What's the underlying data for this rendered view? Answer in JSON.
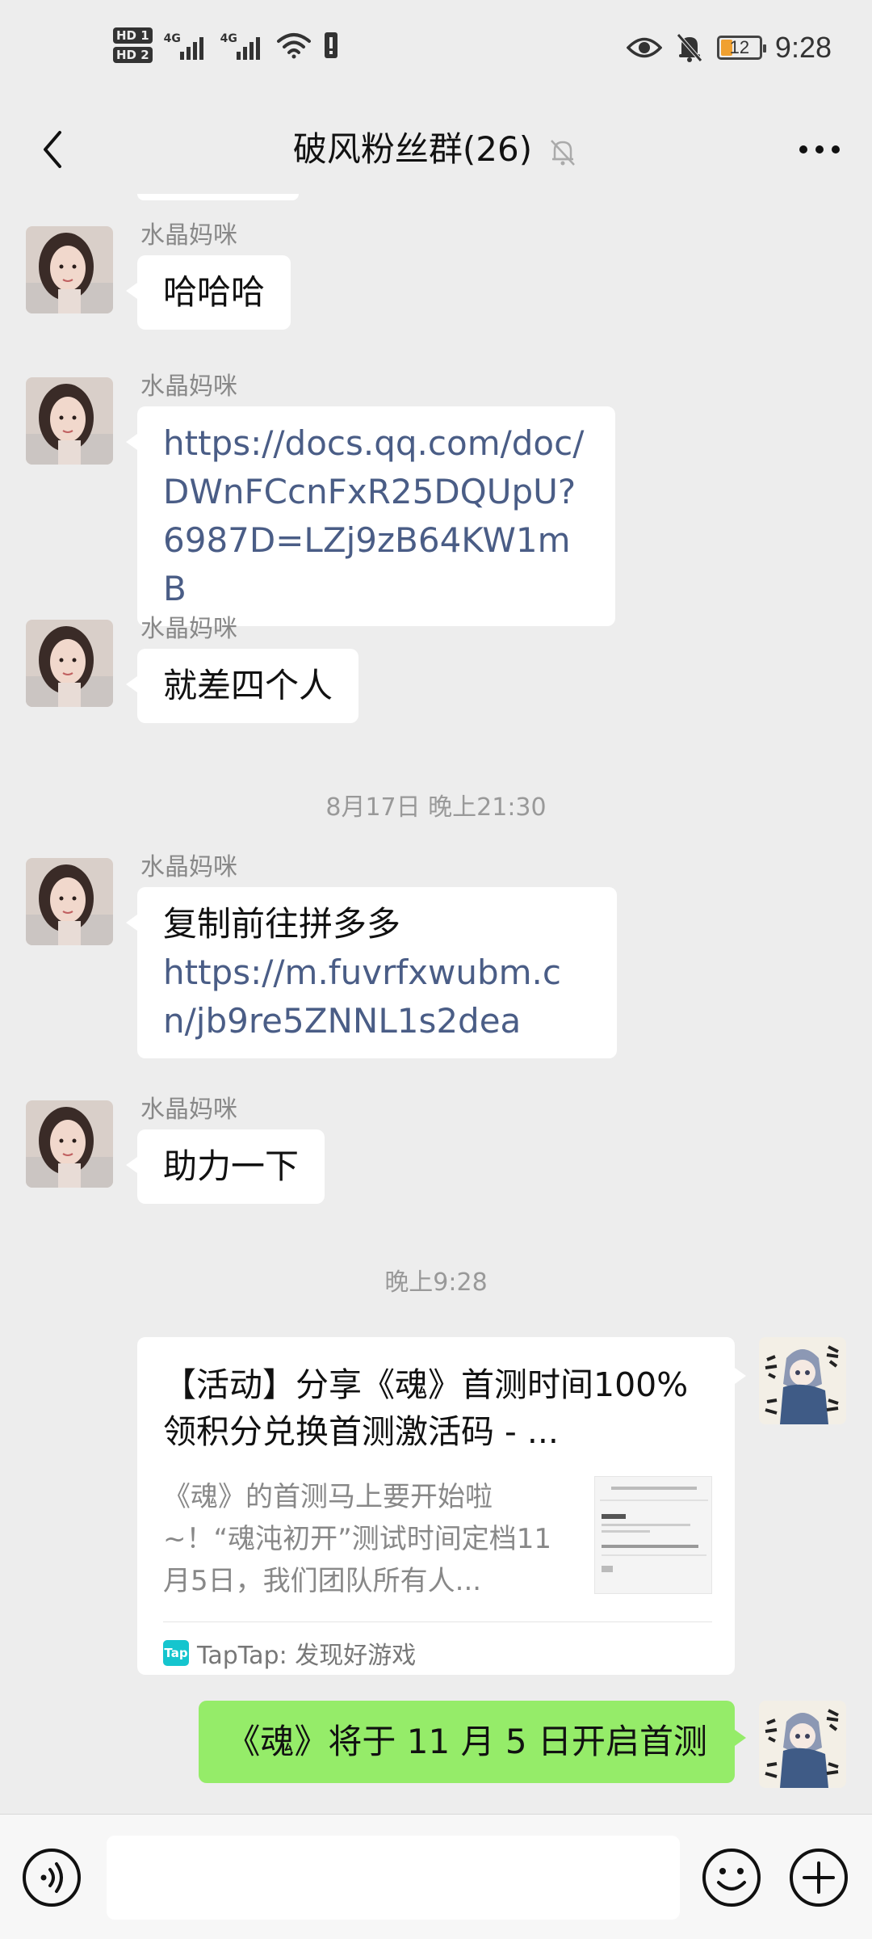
{
  "status_bar": {
    "sim1": "HD 1",
    "sim2": "HD 2",
    "network1": "4G",
    "network2": "4G",
    "battery": "12",
    "time": "9:28"
  },
  "header": {
    "title": "破风粉丝群(26)",
    "back_icon": "chevron-left-icon",
    "mute_icon": "bell-off-icon",
    "more_icon": "more-dots-icon"
  },
  "messages": [
    {
      "sender": "水晶妈咪",
      "text": "哈哈哈"
    },
    {
      "sender": "水晶妈咪",
      "link": "https://docs.qq.com/doc/DWnFCcnFxR25DQUpU?6987D=LZj9zB64KW1mB"
    },
    {
      "sender": "水晶妈咪",
      "text": "就差四个人"
    },
    {
      "sender": "水晶妈咪",
      "text": "复制前往拼多多",
      "link": "https://m.fuvrfxwubm.cn/jb9re5ZNNL1s2dea"
    },
    {
      "sender": "水晶妈咪",
      "text": "助力一下"
    }
  ],
  "timestamps": {
    "t1": "8月17日 晚上21:30",
    "t2": "晚上9:28"
  },
  "share_card": {
    "title": "【活动】分享《魂》首测时间100%领积分兑换首测激活码 - ...",
    "description": "《魂》的首测马上要开始啦~！“魂沌初开”测试时间定档11月5日，我们团队所有人...",
    "source_logo": "Tap",
    "source": "TapTap: 发现好游戏"
  },
  "my_message": "《魂》将于 11 月 5 日开启首测",
  "input_bar": {
    "voice_icon": "voice-icon",
    "emoji_icon": "emoji-icon",
    "plus_icon": "plus-icon"
  },
  "colors": {
    "background": "#ededed",
    "my_bubble": "#95ec69",
    "link": "#4a5d86",
    "taptap": "#15c5ce"
  }
}
